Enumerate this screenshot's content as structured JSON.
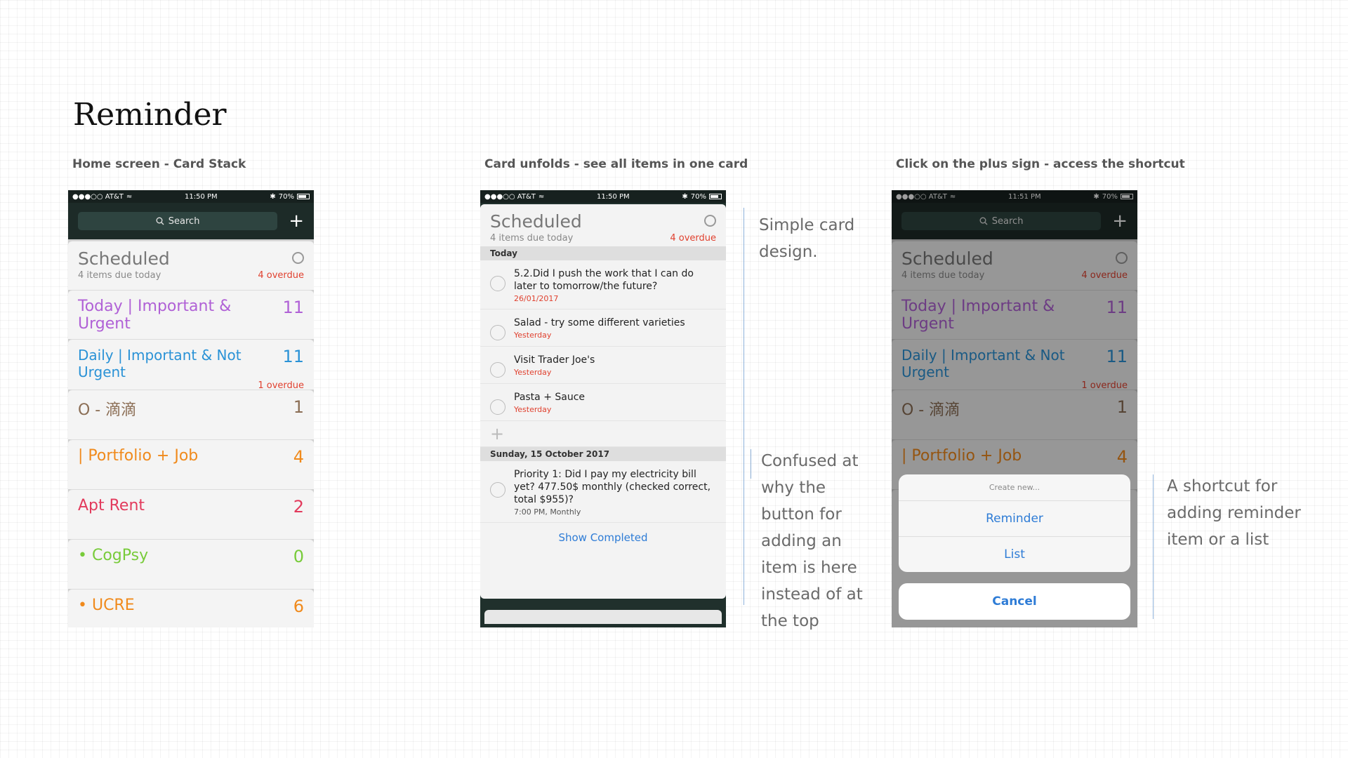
{
  "page": {
    "title": "Reminder"
  },
  "captions": [
    "Home screen - Card Stack",
    "Card unfolds - see all items in one card",
    "Click on the plus sign - access the shortcut"
  ],
  "status": {
    "carrier": "●●●○○ AT&T",
    "wifi": "≈",
    "battery": "70%",
    "bluetooth": "✱",
    "time1": "11:50 PM",
    "time2": "11:50 PM",
    "time3": "11:51 PM"
  },
  "search": {
    "label": "Search",
    "icon": "search-icon"
  },
  "plus_symbol": "+",
  "scheduled": {
    "title": "Scheduled",
    "due": "4 items due today",
    "overdue": "4 overdue"
  },
  "lists": [
    {
      "name": "Today | Important & Urgent",
      "count": "11",
      "color": "#b061d6"
    },
    {
      "name": "Daily | Important & Not Urgent",
      "count": "11",
      "overdue": "1 overdue",
      "color": "#2a92d6"
    },
    {
      "name": "O - 滴滴",
      "count": "1",
      "color": "#8b6e55"
    },
    {
      "name": " | Portfolio + Job",
      "count": "4",
      "color": "#f08a1c"
    },
    {
      "name": "Apt Rent",
      "count": "2",
      "color": "#e23a5c"
    },
    {
      "name": "• CogPsy",
      "count": "0",
      "color": "#78cb3a"
    },
    {
      "name": "• UCRE",
      "count": "6",
      "color": "#f08a1c"
    }
  ],
  "open_card": {
    "today_header": "Today",
    "items": [
      {
        "text": "5.2.Did I push the work that I can do later to tomorrow/the future?",
        "meta": "26/01/2017"
      },
      {
        "text": "Salad - try some different varieties",
        "meta": "Yesterday"
      },
      {
        "text": "Visit Trader Joe's",
        "meta": "Yesterday"
      },
      {
        "text": "Pasta + Sauce",
        "meta": "Yesterday"
      }
    ],
    "sunday_header": "Sunday, 15 October 2017",
    "sunday_item": {
      "text": "Priority 1: Did I pay my electricity bill yet? 477.50$ monthly (checked correct, total $955)?",
      "meta": "7:00 PM, Monthly"
    },
    "show_completed": "Show Completed"
  },
  "notes": {
    "note1": "Simple card design.",
    "note2": "Confused at why the button for adding an item is here instead of at the top",
    "note3": "A shortcut for adding reminder item or a list"
  },
  "sheet": {
    "header": "Create new...",
    "reminder": "Reminder",
    "list": "List",
    "cancel": "Cancel"
  }
}
